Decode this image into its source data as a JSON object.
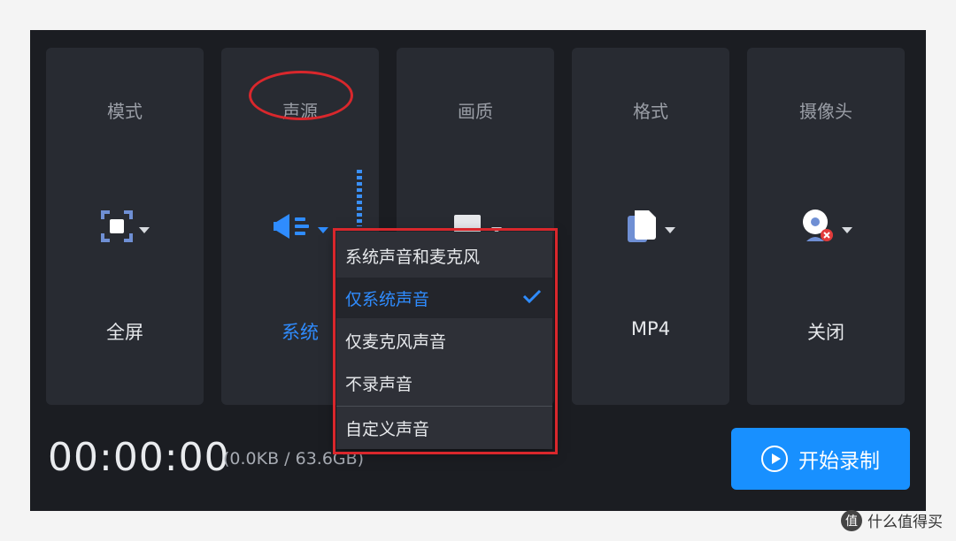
{
  "cards": [
    {
      "title": "模式",
      "value": "全屏",
      "icon": "fullscreen-icon"
    },
    {
      "title": "声源",
      "value": "系统",
      "icon": "speaker-icon"
    },
    {
      "title": "画质",
      "value": "",
      "icon": "monitor-icon"
    },
    {
      "title": "格式",
      "value": "MP4",
      "icon": "file-icon"
    },
    {
      "title": "摄像头",
      "value": "关闭",
      "icon": "camera-off-icon"
    }
  ],
  "dropdown": {
    "items": [
      {
        "label": "系统声音和麦克风",
        "selected": false
      },
      {
        "label": "仅系统声音",
        "selected": true
      },
      {
        "label": "仅麦克风声音",
        "selected": false
      },
      {
        "label": "不录声音",
        "selected": false
      },
      {
        "label": "自定义声音",
        "selected": false
      }
    ]
  },
  "status": {
    "timer": "00:00:00",
    "storage": "(0.0KB / 63.6GB)"
  },
  "record_button": {
    "label": "开始录制"
  },
  "watermark": {
    "text": "什么值得买",
    "logo": "值"
  },
  "colors": {
    "accent": "#1890ff",
    "annotation": "#d9272c",
    "panel": "#282b32",
    "background": "#1b1d22"
  }
}
